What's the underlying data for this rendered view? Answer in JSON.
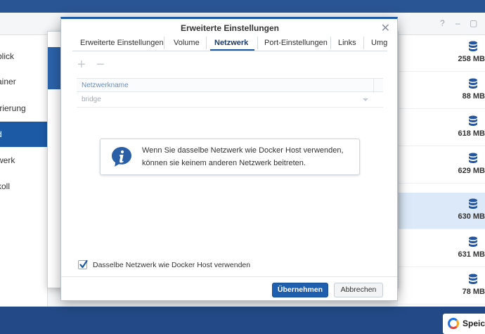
{
  "background": {
    "sidebar_items": [
      "blick",
      "ainer",
      "trierung",
      "d",
      "werk",
      "koll"
    ],
    "active_sidebar_index": 3,
    "sizes": [
      "258 MB",
      "88 MB",
      "618 MB",
      "629 MB",
      "630 MB",
      "631 MB",
      "78 MB"
    ],
    "selected_size_index": 4,
    "taskbar_app": "Speic"
  },
  "dialog": {
    "title": "Erweiterte Einstellungen",
    "tabs": [
      "Erweiterte Einstellungen",
      "Volume",
      "Netzwerk",
      "Port-Einstellungen",
      "Links",
      "Umge"
    ],
    "active_tab": "Netzwerk",
    "grid": {
      "column_header": "Netzwerkname",
      "row_value": "bridge"
    },
    "info": {
      "line1": "Wenn Sie dasselbe Netzwerk wie Docker Host verwenden,",
      "line2": "können sie keinem anderen Netzwerk beitreten."
    },
    "checkbox": {
      "label": "Dasselbe Netzwerk wie Docker Host verwenden",
      "checked": true
    },
    "buttons": {
      "apply": "Übernehmen",
      "cancel": "Abbrechen"
    }
  },
  "colors": {
    "accent": "#1d5aa6",
    "primary_button": "#1f5fb0"
  }
}
